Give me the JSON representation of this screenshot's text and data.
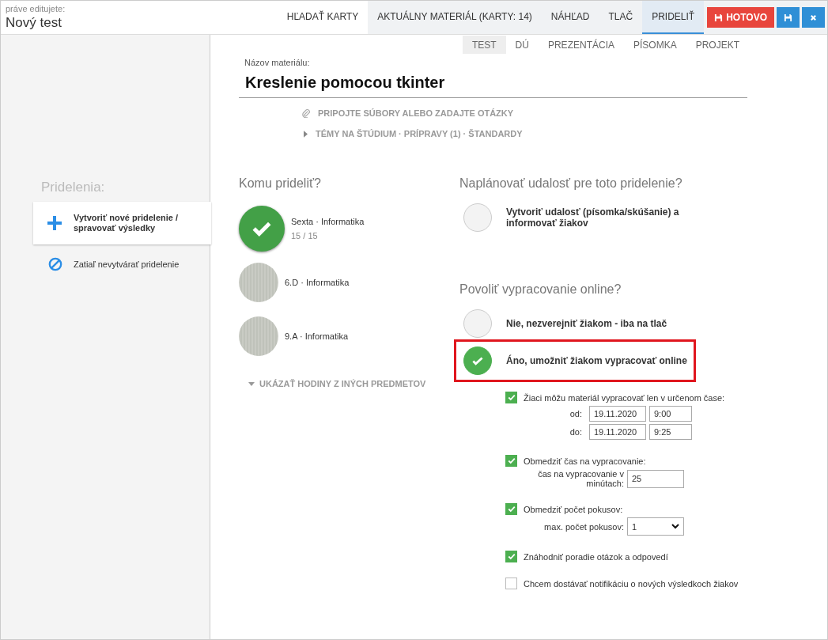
{
  "header": {
    "caption": "práve editujete:",
    "title": "Nový test"
  },
  "tabs": [
    {
      "label": "HĽADAŤ KARTY",
      "selected": false
    },
    {
      "label": "AKTUÁLNY MATERIÁL (KARTY: 14)",
      "selected": false
    },
    {
      "label": "NÁHĽAD",
      "selected": false
    },
    {
      "label": "TLAČ",
      "selected": false
    },
    {
      "label": "PRIDELIŤ",
      "selected": true
    }
  ],
  "done_button": "HOTOVO",
  "type_tabs": [
    {
      "label": "TEST",
      "selected": true
    },
    {
      "label": "DÚ",
      "selected": false
    },
    {
      "label": "PREZENTÁCIA",
      "selected": false
    },
    {
      "label": "PÍSOMKA",
      "selected": false
    },
    {
      "label": "PROJEKT",
      "selected": false
    }
  ],
  "material": {
    "label": "Názov materiálu:",
    "value": "Kreslenie pomocou tkinter",
    "attach_link": "PRIPOJTE SÚBORY ALEBO ZADAJTE OTÁZKY",
    "topics_link": "TÉMY NA ŠTÚDIUM · PRÍPRAVY (1) · ŠTANDARDY"
  },
  "sidebar": {
    "heading": "Pridelenia:",
    "items": [
      {
        "kind": "create",
        "label": "Vytvoriť nové pridelenie / spravovať výsledky",
        "selected": true
      },
      {
        "kind": "none",
        "label": "Zatiaľ nevytvárať pridelenie",
        "selected": false
      }
    ]
  },
  "recipients": {
    "heading": "Komu prideliť?",
    "classes": [
      {
        "name": "Sexta · Informatika",
        "count": "15 / 15",
        "selected": true
      },
      {
        "name": "6.D · Informatika",
        "selected": false
      },
      {
        "name": "9.A · Informatika",
        "selected": false
      }
    ],
    "more_link": "UKÁZAŤ HODINY Z INÝCH PREDMETOV"
  },
  "event": {
    "heading": "Naplánovať udalosť pre toto pridelenie?",
    "option": {
      "label": "Vytvoriť udalosť (písomka/skúšanie) a informovať žiakov",
      "selected": false
    }
  },
  "online": {
    "heading": "Povoliť vypracovanie online?",
    "options": [
      {
        "label": "Nie, nezverejniť žiakom - iba na tlač",
        "selected": false,
        "highlighted": false
      },
      {
        "label": "Áno, umožniť žiakom vypracovať online",
        "selected": true,
        "highlighted": true
      }
    ]
  },
  "settings": [
    {
      "kind": "window",
      "label": "Žiaci môžu materiál vypracovať len v určenom čase:",
      "checked": true,
      "rows": [
        {
          "label": "od:",
          "date": "19.11.2020",
          "time": "9:00"
        },
        {
          "label": "do:",
          "date": "19.11.2020",
          "time": "9:25"
        }
      ]
    },
    {
      "kind": "input",
      "label": "Obmedziť čas na vypracovanie:",
      "checked": true,
      "field_label": "čas na vypracovanie v minútach:",
      "value": "25"
    },
    {
      "kind": "select",
      "label": "Obmedziť počet pokusov:",
      "checked": true,
      "field_label": "max. počet pokusov:",
      "value": "1"
    },
    {
      "kind": "plain",
      "label": "Znáhodniť poradie otázok a odpovedí",
      "checked": true
    },
    {
      "kind": "plain",
      "label": "Chcem dostávať notifikáciu o nových výsledkoch žiakov",
      "checked": false
    }
  ]
}
